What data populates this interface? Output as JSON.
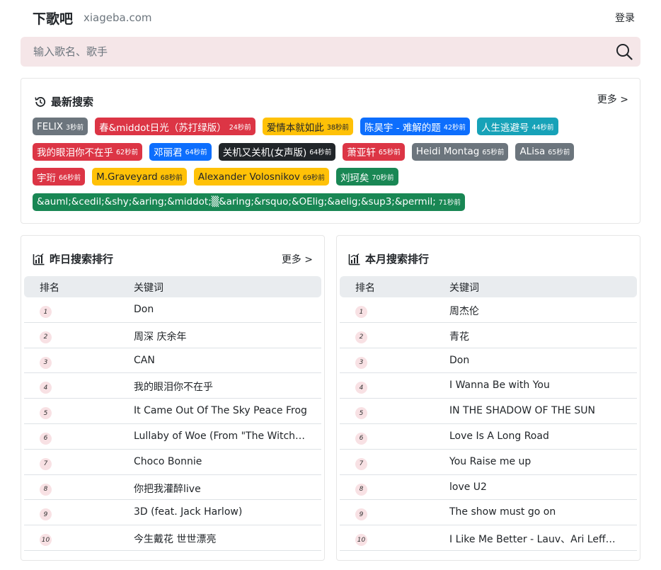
{
  "header": {
    "brand": "下歌吧",
    "domain": "xiageba.com",
    "login": "登录"
  },
  "search": {
    "placeholder": "输入歌名、歌手"
  },
  "recent": {
    "title": "最新搜索",
    "more": "更多 >",
    "rows": [
      [
        {
          "label": "FELIX",
          "ago": "3秒前",
          "color": "secondary"
        },
        {
          "label": "春&middot日光（苏打绿版）",
          "ago": "24秒前",
          "color": "danger"
        },
        {
          "label": "爱情本就如此",
          "ago": "38秒前",
          "color": "warning"
        },
        {
          "label": "陈昊宇 - 难解的题",
          "ago": "42秒前",
          "color": "primary"
        },
        {
          "label": "人生逃避号",
          "ago": "44秒前",
          "color": "info"
        }
      ],
      [
        {
          "label": "我的眼泪你不在乎",
          "ago": "62秒前",
          "color": "danger"
        },
        {
          "label": "邓丽君",
          "ago": "64秒前",
          "color": "primary"
        },
        {
          "label": "关机又关机(女声版)",
          "ago": "64秒前",
          "color": "dark"
        },
        {
          "label": "萧亚轩",
          "ago": "65秒前",
          "color": "danger"
        },
        {
          "label": "Heidi Montag",
          "ago": "65秒前",
          "color": "secondary"
        },
        {
          "label": "ALisa",
          "ago": "65秒前",
          "color": "secondary"
        }
      ],
      [
        {
          "label": "宇珩",
          "ago": "66秒前",
          "color": "danger"
        },
        {
          "label": "M.Graveyard",
          "ago": "68秒前",
          "color": "warning"
        },
        {
          "label": "Alexander Volosnikov",
          "ago": "69秒前",
          "color": "warning"
        },
        {
          "label": "刘珂矣",
          "ago": "70秒前",
          "color": "success"
        }
      ],
      [
        {
          "label": "&auml;&cedil;&shy;&aring;&middot;▒&aring;&rsquo;&OElig;&aelig;&sup3;&permil;",
          "ago": "71秒前",
          "color": "success"
        }
      ]
    ]
  },
  "yesterday": {
    "title": "昨日搜索排行",
    "more": "更多 >",
    "col_rank": "排名",
    "col_keyword": "关键词",
    "items": [
      {
        "rank": "1",
        "keyword": "Don"
      },
      {
        "rank": "2",
        "keyword": "周深 庆余年"
      },
      {
        "rank": "3",
        "keyword": "CAN"
      },
      {
        "rank": "4",
        "keyword": "我的眼泪你不在乎"
      },
      {
        "rank": "5",
        "keyword": "It Came Out Of The Sky Peace Frog"
      },
      {
        "rank": "6",
        "keyword": "Lullaby of Woe (From \"The Witche..."
      },
      {
        "rank": "7",
        "keyword": "Choco Bonnie"
      },
      {
        "rank": "8",
        "keyword": "你把我灌醉live"
      },
      {
        "rank": "9",
        "keyword": "3D (feat. Jack Harlow)"
      },
      {
        "rank": "10",
        "keyword": "今生戴花 世世漂亮"
      }
    ]
  },
  "month": {
    "title": "本月搜索排行",
    "col_rank": "排名",
    "col_keyword": "关键词",
    "items": [
      {
        "rank": "1",
        "keyword": "周杰伦"
      },
      {
        "rank": "2",
        "keyword": "青花"
      },
      {
        "rank": "3",
        "keyword": "Don"
      },
      {
        "rank": "4",
        "keyword": "I Wanna Be with You"
      },
      {
        "rank": "5",
        "keyword": "IN THE SHADOW OF THE SUN"
      },
      {
        "rank": "6",
        "keyword": "Love Is A Long Road"
      },
      {
        "rank": "7",
        "keyword": "You Raise me up"
      },
      {
        "rank": "8",
        "keyword": "love U2"
      },
      {
        "rank": "9",
        "keyword": "The show must go on"
      },
      {
        "rank": "10",
        "keyword": "I Like Me Better - Lauv、Ari Leff、..."
      }
    ]
  },
  "colors": {
    "search_bg": "#f5e6e8",
    "rank_badge_bg": "#f8e1e4",
    "secondary": "#6c757d",
    "danger": "#dc3545",
    "warning": "#ffc107",
    "primary": "#0d6efd",
    "info": "#17a2b8",
    "dark": "#212529",
    "success": "#198754"
  },
  "icons": {
    "search": "magnifier-icon",
    "recent": "history-icon",
    "ranking": "bar-chart-icon"
  }
}
